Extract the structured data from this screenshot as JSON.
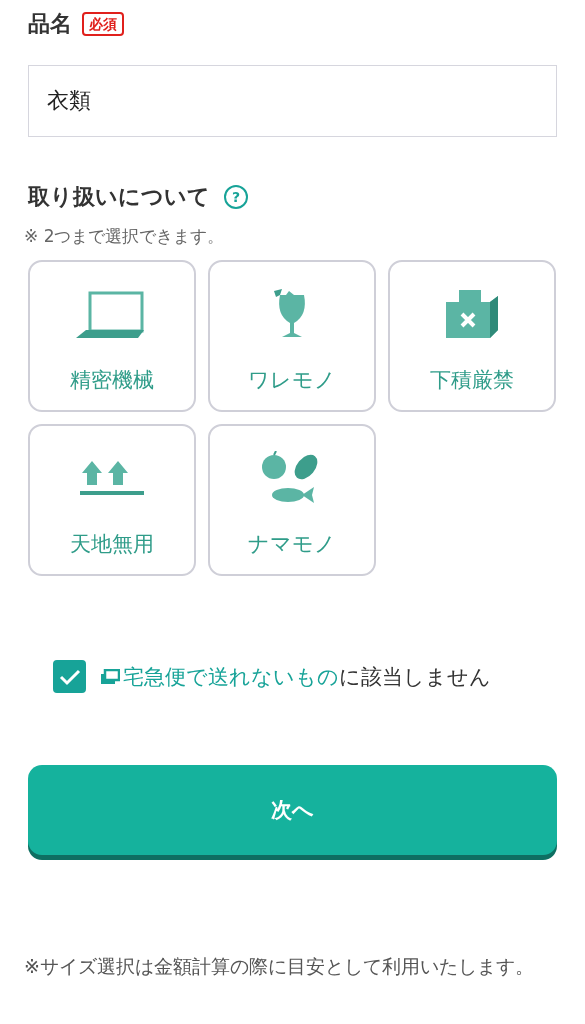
{
  "item_name": {
    "label": "品名",
    "badge": "必須",
    "value": "衣類"
  },
  "handling": {
    "title": "取り扱いについて",
    "help": "?",
    "note": "※ 2つまで選択できます。",
    "options": [
      {
        "label": "精密機械",
        "kind": "laptop",
        "selected": false
      },
      {
        "label": "ワレモノ",
        "kind": "glass",
        "selected": false
      },
      {
        "label": "下積厳禁",
        "kind": "box",
        "selected": false
      },
      {
        "label": "天地無用",
        "kind": "arrows",
        "selected": false
      },
      {
        "label": "ナマモノ",
        "kind": "food",
        "selected": false
      }
    ]
  },
  "agreement": {
    "checked": true,
    "link": "宅急便で送れないもの",
    "text": "に該当しません"
  },
  "next_button": "次へ",
  "footer_note": {
    "mark": "※",
    "text": "サイズ選択は金額計算の際に目安として利用いたします。"
  }
}
